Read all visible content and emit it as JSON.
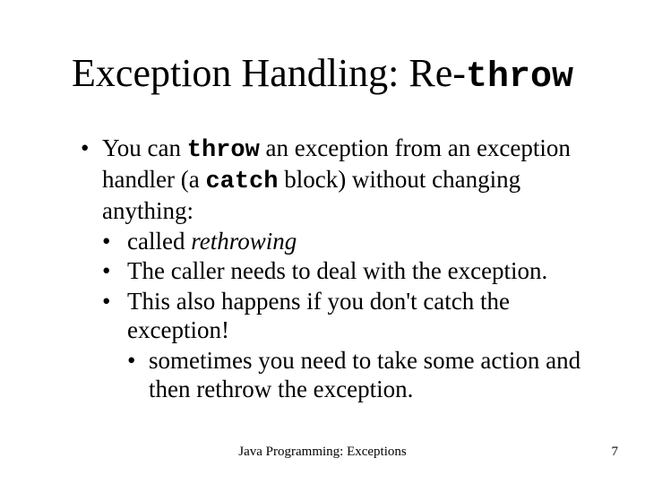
{
  "title": {
    "prefix": "Exception Handling: Re-",
    "code": "throw"
  },
  "bullets": {
    "main": {
      "pre": "You can ",
      "code1": "throw",
      "mid": " an exception from an exception handler (a ",
      "code2": "catch",
      "post": " block) without changing anything:"
    },
    "sub1": {
      "pre": "called ",
      "ital": "rethrowing"
    },
    "sub2": "The caller needs to deal with the exception.",
    "sub3": "This also happens if you don't catch the exception!",
    "sub3a": "sometimes you need to take some action and then rethrow the exception."
  },
  "footer": {
    "center": "Java Programming: Exceptions",
    "page": "7"
  }
}
